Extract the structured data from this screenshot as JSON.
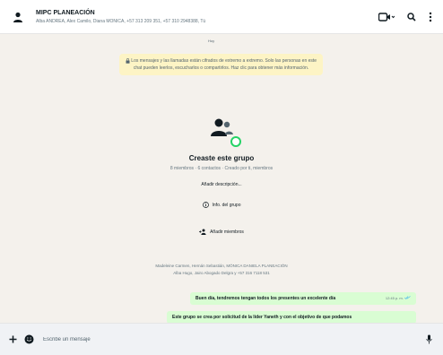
{
  "header": {
    "title": "MIPC PLANEACIÓN",
    "members": "Alba ANDREA, Alex Camilo, Diana MONICA, +57 313 209 351, +57 310 2948388, Tú"
  },
  "chat": {
    "date_pill": "Hoy",
    "encryption_notice": "Los mensajes y las llamadas están cifrados de extremo a extremo. Solo las personas en este chat pueden leerlos, escucharlos o compartirlos. Haz clic para obtener más información.",
    "group_card": {
      "title": "Creaste este grupo",
      "subtitle": "8 miembros · 6 contactos · Creado por ti, miembros",
      "add_description": "Añadir descripción...",
      "info_label": "Info. del grupo",
      "add_members_label": "Añadir miembros"
    },
    "system_messages": [
      "Madeleine Carmen, Hernán Sebastián, MÓNICA DANIELA PLANEACIÓN",
      "Alba Hugo, Jairo Abogado Delgra y +57 316 7118 531"
    ],
    "messages": [
      {
        "text": "Buen día, tendremos tengan todos los presentes un excelente día",
        "time": "12:45 p. m."
      },
      {
        "text": "Este grupo se crea por solicitud de la líder Yaneth y con el objetivo de que podamos"
      }
    ]
  },
  "composer": {
    "placeholder": "Escribe un mensaje"
  }
}
